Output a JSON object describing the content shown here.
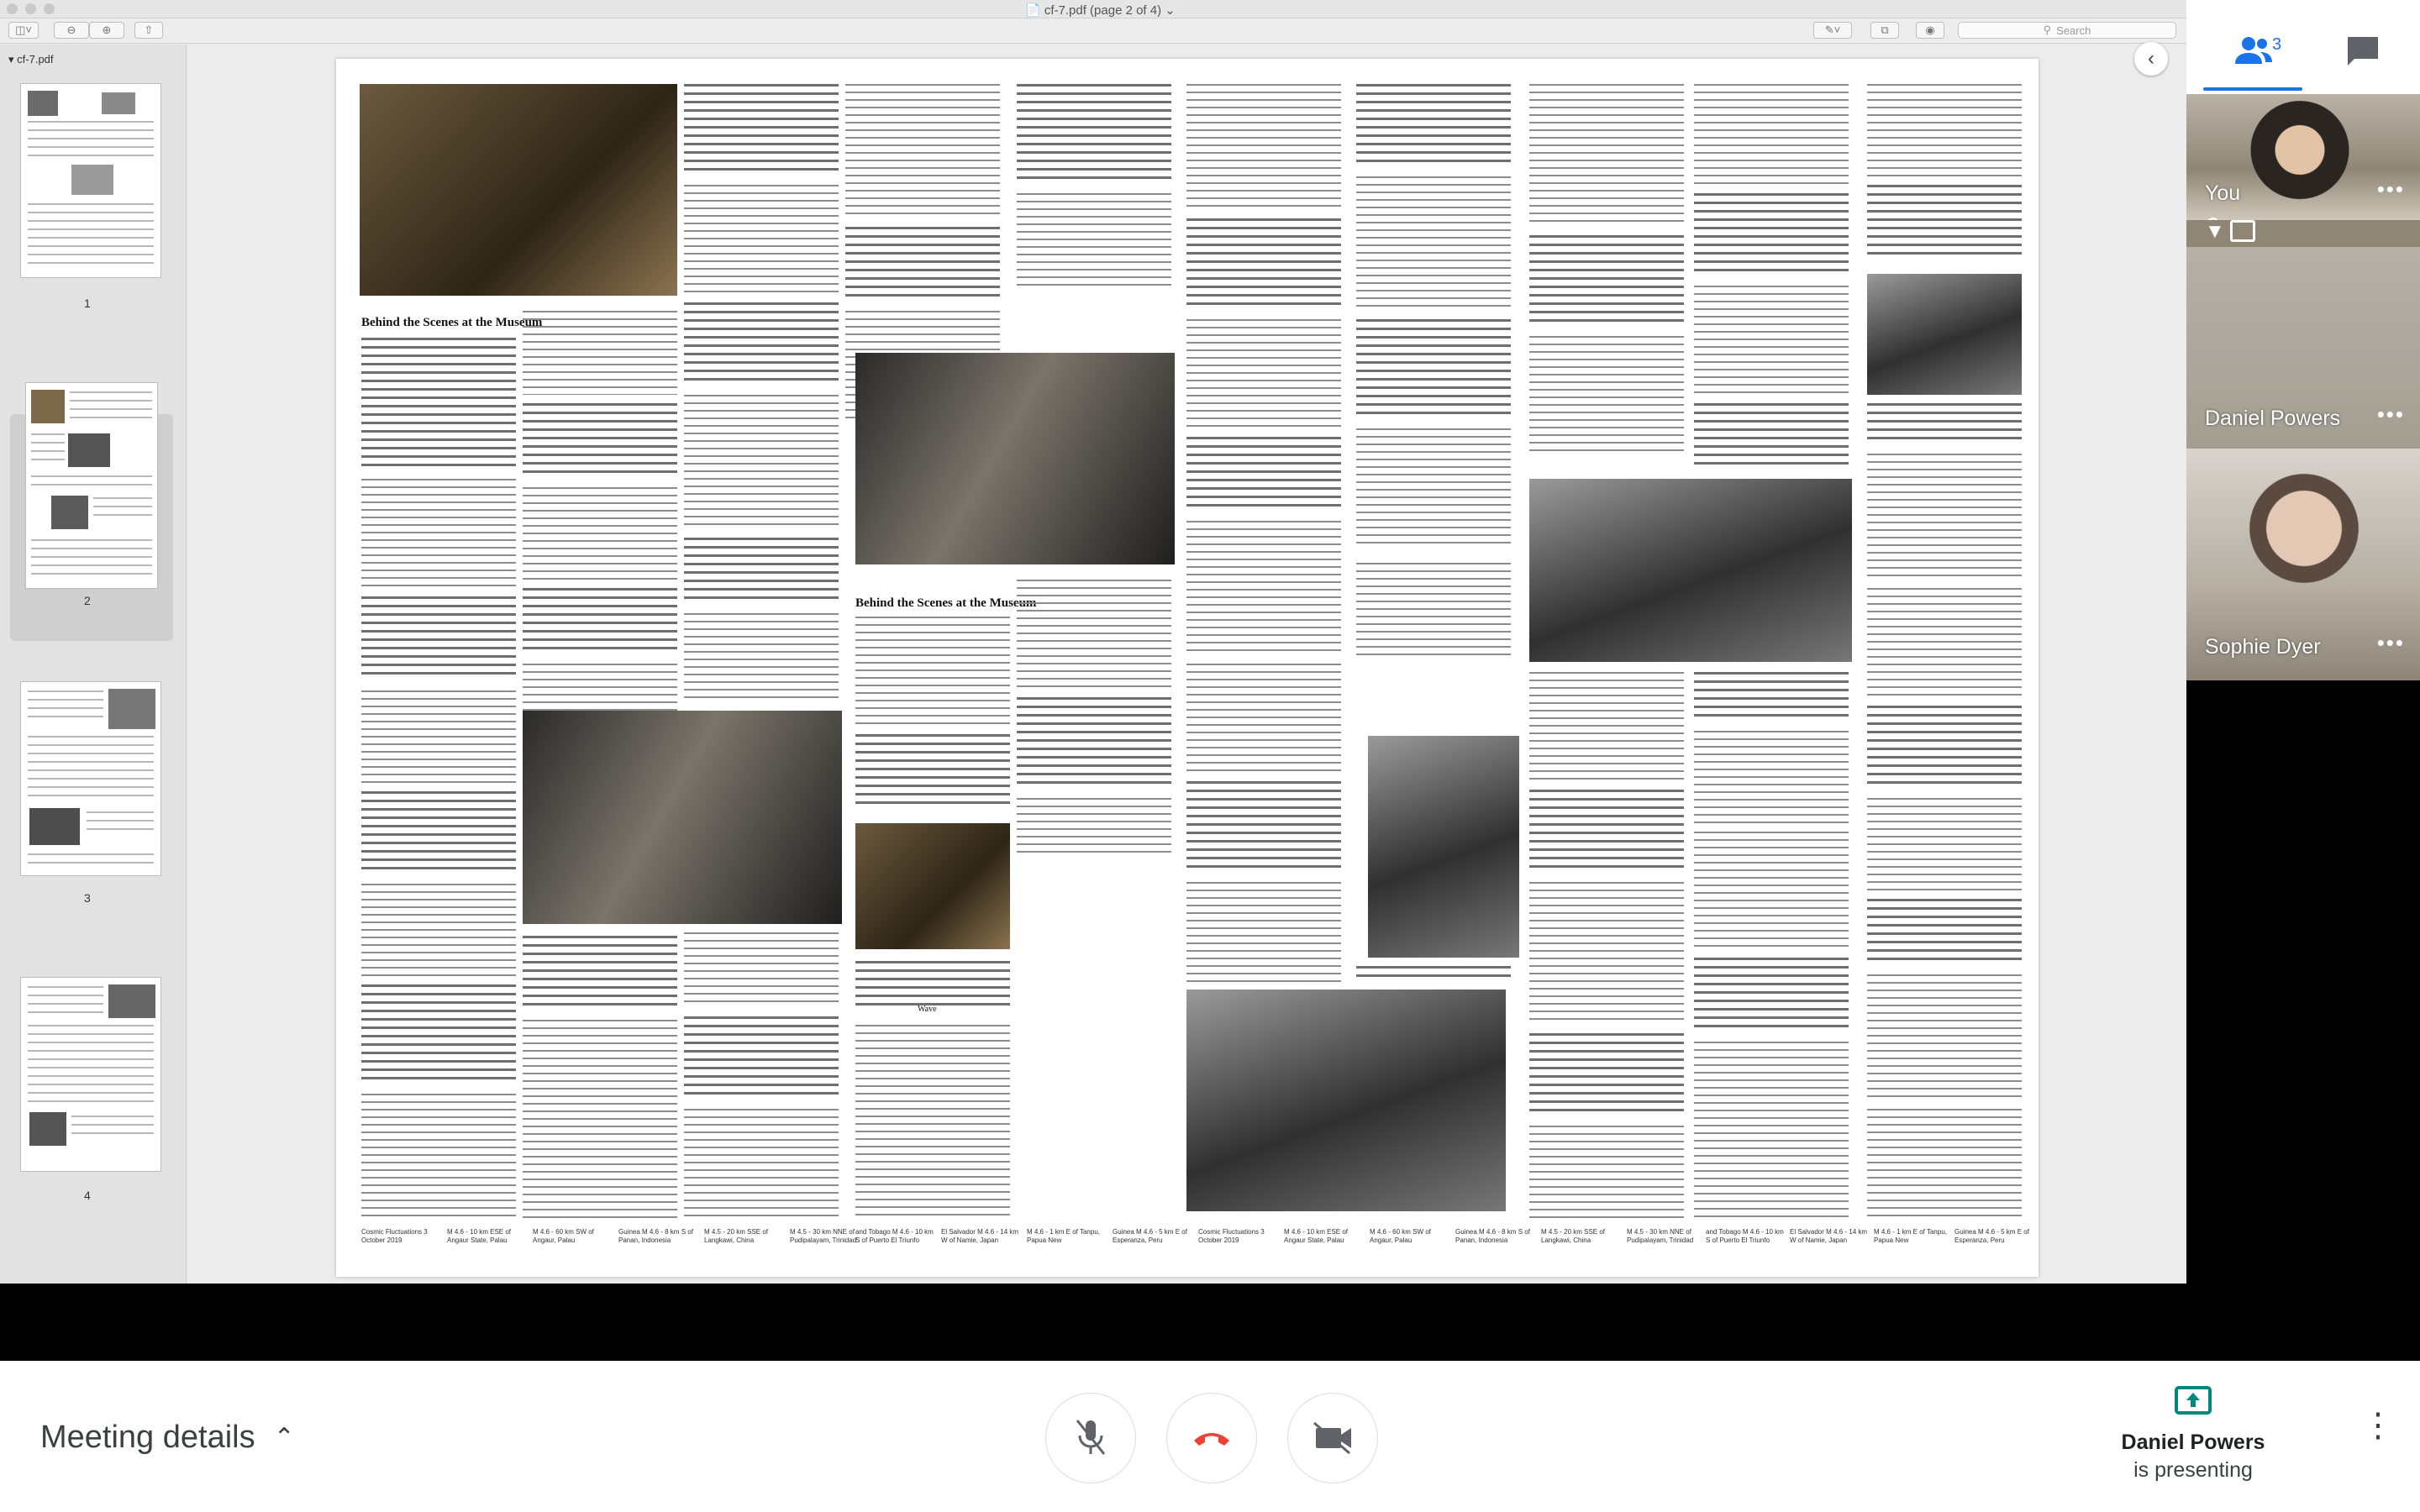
{
  "viewer": {
    "document_title": "cf-7.pdf (page 2 of 4)",
    "search_placeholder": "Search",
    "sidebar_filename": "cf-7.pdf",
    "thumbnails": [
      {
        "label": "1"
      },
      {
        "label": "2"
      },
      {
        "label": "3"
      },
      {
        "label": "4"
      }
    ],
    "selected_thumbnail": "2",
    "page": {
      "headline_1": "Behind the Scenes at the Museum",
      "headline_2": "Behind the Scenes at the Museum",
      "section_label": "Wave",
      "footer": [
        "Cosmic Fluctuations 3 October 2019",
        "M 4.6 - 10 km ESE of Angaur State, Palau",
        "M 4.6 - 60 km SW of Angaur, Palau",
        "Guinea M 4.6 - 8 km S of Panan, Indonesia",
        "M 4.5 - 20 km SSE of Langkawi, China",
        "M 4.5 - 30 km NNE of Pudipalayam, Trinidad",
        "and Tobago M 4.6 - 10 km S of Puerto El Triunfo",
        "El Salvador M 4.6 - 14 km W of Namie, Japan",
        "M 4.6 - 1 km E of Tanpu, Papua New",
        "Guinea M 4.6 - 5 km E of Esperanza, Peru"
      ]
    }
  },
  "meeting": {
    "participant_count": "3",
    "participants": [
      {
        "name": "You"
      },
      {
        "name": "Daniel Powers"
      },
      {
        "name": "Sophie Dyer"
      }
    ],
    "meeting_details_label": "Meeting details",
    "presenter_name": "Daniel Powers",
    "presenter_status": "is presenting",
    "colors": {
      "accent": "#1a73e8",
      "end_call": "#ea4335",
      "present_icon": "#00897b"
    }
  }
}
